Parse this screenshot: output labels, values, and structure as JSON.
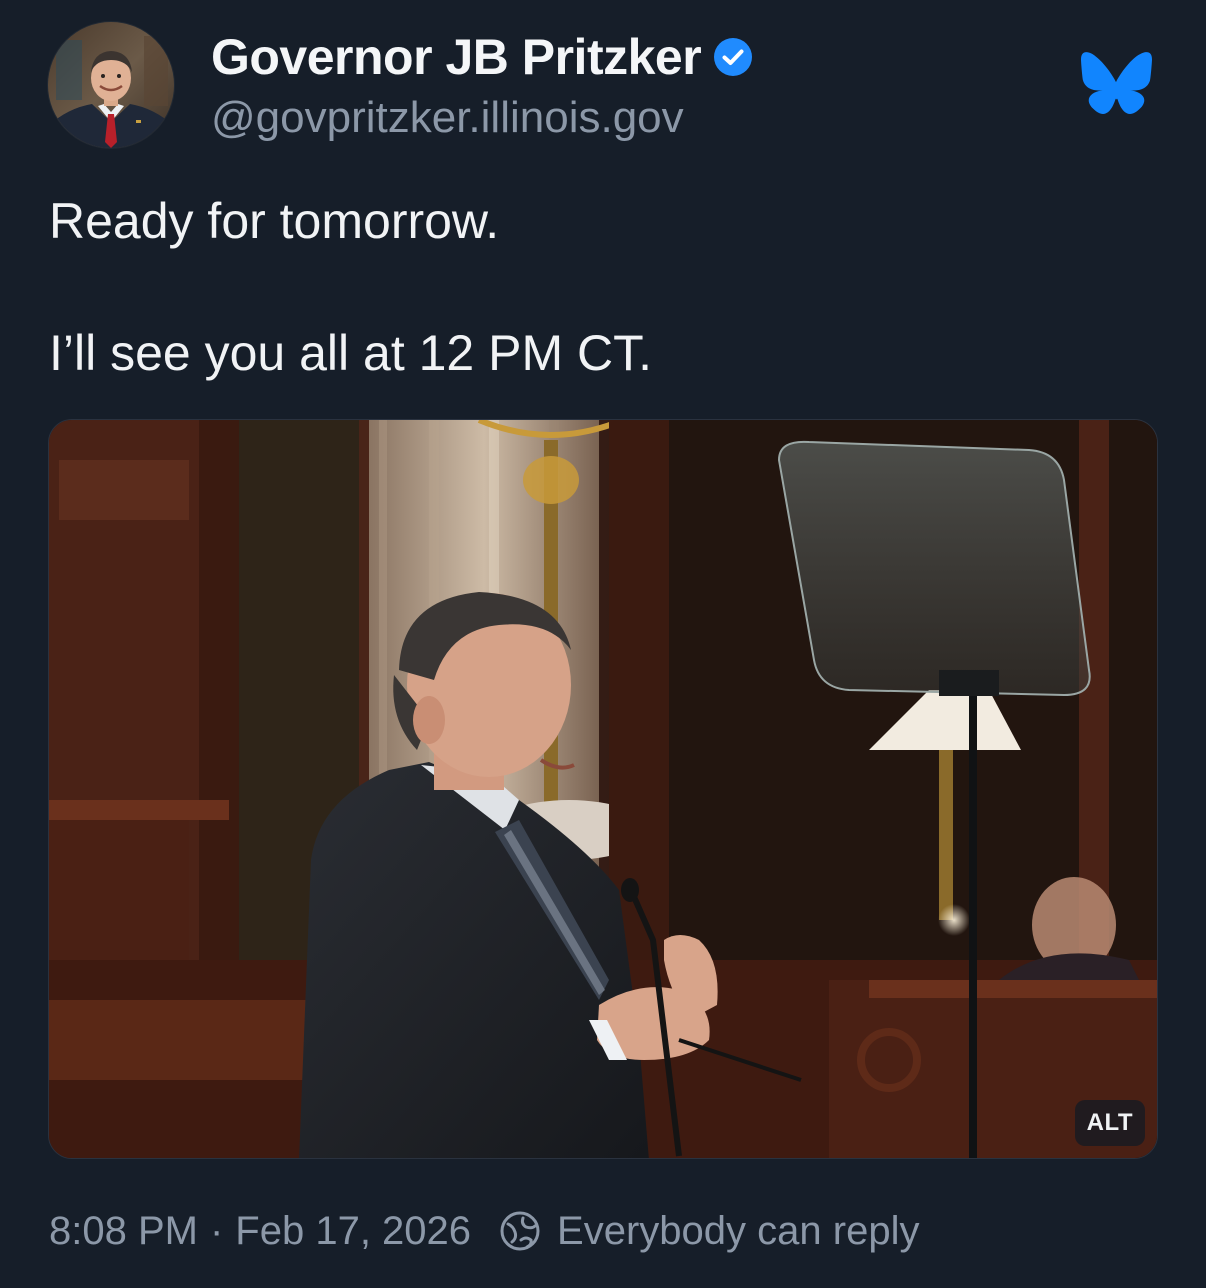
{
  "author": {
    "display_name": "Governor JB Pritzker",
    "handle": "@govpritzker.illinois.gov",
    "verified": true,
    "avatar_icon": "avatar-photo"
  },
  "post": {
    "line1": "Ready for tomorrow.",
    "line2": "I’ll see you all at 12 PM CT."
  },
  "media": {
    "alt_label": "ALT",
    "image": "photo-speaker-at-podium"
  },
  "footer": {
    "time": "8:08 PM",
    "separator": "·",
    "date": "Feb 17, 2026",
    "reply_setting": "Everybody can reply",
    "reply_icon": "globe-icon"
  },
  "colors": {
    "background": "#161e29",
    "text": "#f1f3f5",
    "muted": "#8c98a8",
    "brand_blue": "#1185fe",
    "verified_blue": "#208bfe"
  }
}
